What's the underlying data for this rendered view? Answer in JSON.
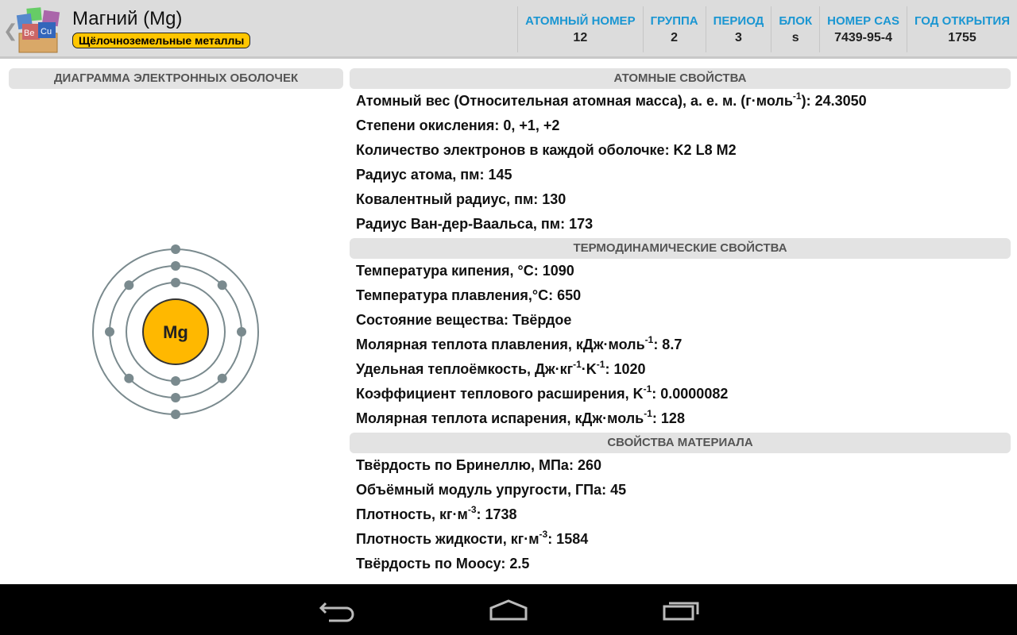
{
  "header": {
    "title": "Магний (Mg)",
    "category": "Щёлочноземельные металлы",
    "category_color": "#ffc600",
    "stats": [
      {
        "label": "АТОМНЫЙ НОМЕР",
        "value": "12"
      },
      {
        "label": "ГРУППА",
        "value": "2"
      },
      {
        "label": "ПЕРИОД",
        "value": "3"
      },
      {
        "label": "БЛОК",
        "value": "s"
      },
      {
        "label": "НОМЕР CAS",
        "value": "7439-95-4"
      },
      {
        "label": "ГОД ОТКРЫТИЯ",
        "value": "1755"
      }
    ]
  },
  "diagram": {
    "title": "ДИАГРАММА ЭЛЕКТРОННЫХ ОБОЛОЧЕК",
    "symbol": "Mg",
    "shells": [
      2,
      8,
      2
    ],
    "nucleus_color": "#ffb800"
  },
  "sections": [
    {
      "title": "АТОМНЫЕ СВОЙСТВА",
      "rows": [
        [
          {
            "t": "Атомный вес (Относительная атомная масса), а. е. м. (г·моль"
          },
          {
            "s": "-1"
          },
          {
            "t": "): 24.3050"
          }
        ],
        [
          {
            "t": "Степени окисления: 0, +1, +2"
          }
        ],
        [
          {
            "t": "Количество электронов в каждой оболочке: K2 L8 M2"
          }
        ],
        [
          {
            "t": "Радиус атома, пм: 145"
          }
        ],
        [
          {
            "t": "Ковалентный радиус, пм: 130"
          }
        ],
        [
          {
            "t": "Радиус Ван-дер-Ваальса, пм: 173"
          }
        ]
      ]
    },
    {
      "title": "ТЕРМОДИНАМИЧЕСКИЕ СВОЙСТВА",
      "rows": [
        [
          {
            "t": "Температура кипения, °C: 1090"
          }
        ],
        [
          {
            "t": "Температура плавления,°C: 650"
          }
        ],
        [
          {
            "t": "Состояние вещества: Твёрдое"
          }
        ],
        [
          {
            "t": "Молярная теплота плавления, кДж·моль"
          },
          {
            "s": "-1"
          },
          {
            "t": ": 8.7"
          }
        ],
        [
          {
            "t": "Удельная теплоёмкость, Дж·кг"
          },
          {
            "s": "-1"
          },
          {
            "t": "·K"
          },
          {
            "s": "-1"
          },
          {
            "t": ": 1020"
          }
        ],
        [
          {
            "t": "Коэффициент теплового расширения, K"
          },
          {
            "s": "-1"
          },
          {
            "t": ": 0.0000082"
          }
        ],
        [
          {
            "t": "Молярная теплота испарения, кДж·моль"
          },
          {
            "s": "-1"
          },
          {
            "t": ": 128"
          }
        ]
      ]
    },
    {
      "title": "СВОЙСТВА МАТЕРИАЛА",
      "rows": [
        [
          {
            "t": "Твёрдость по Бринеллю, МПа: 260"
          }
        ],
        [
          {
            "t": "Объёмный модуль упругости, ГПа: 45"
          }
        ],
        [
          {
            "t": "Плотность, кг·м"
          },
          {
            "s": "-3"
          },
          {
            "t": ": 1738"
          }
        ],
        [
          {
            "t": "Плотность жидкости, кг·м"
          },
          {
            "s": "-3"
          },
          {
            "t": ": 1584"
          }
        ],
        [
          {
            "t": "Твёрдость по Моосу: 2.5"
          }
        ]
      ]
    }
  ]
}
